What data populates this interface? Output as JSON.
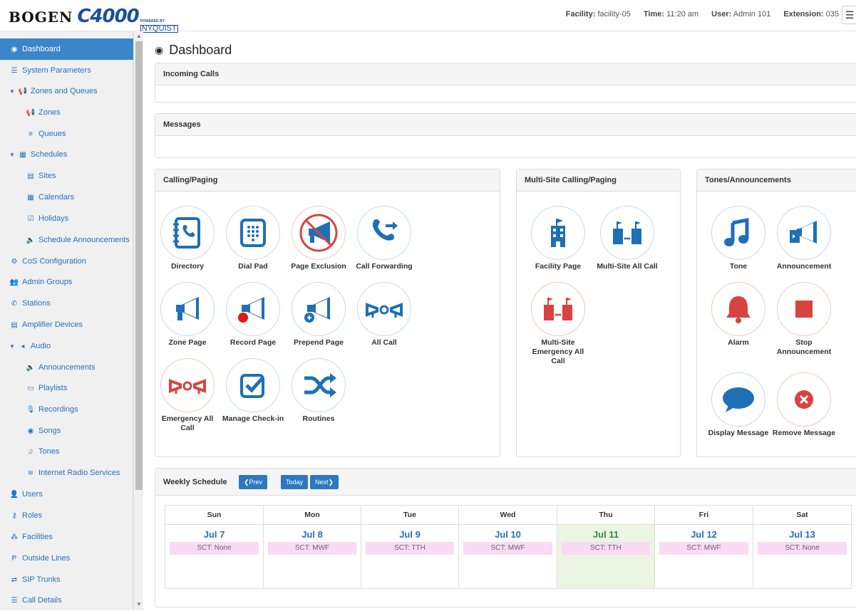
{
  "header": {
    "brand": "BOGEN",
    "product": "C4000",
    "powered_by": "POWERED BY",
    "partner": "NYQUIST",
    "facility_label": "Facility:",
    "facility_value": "facility-05",
    "time_label": "Time:",
    "time_value": "11:20 am",
    "user_label": "User:",
    "user_value": "Admin 101",
    "extension_label": "Extension:",
    "extension_value": "035",
    "menu_icon": "hamburger-icon"
  },
  "sidebar": {
    "items": [
      {
        "label": "Dashboard",
        "icon": "dashboard-icon"
      },
      {
        "label": "System Parameters",
        "icon": "list-icon"
      },
      {
        "label": "Zones and Queues",
        "icon": "megaphone-icon"
      },
      {
        "label": "Zones",
        "icon": "megaphone-icon"
      },
      {
        "label": "Queues",
        "icon": "bars-icon"
      },
      {
        "label": "Schedules",
        "icon": "calendar-icon"
      },
      {
        "label": "Sites",
        "icon": "building-icon"
      },
      {
        "label": "Calendars",
        "icon": "calendar-icon"
      },
      {
        "label": "Holidays",
        "icon": "calendar-check-icon"
      },
      {
        "label": "Schedule Announcements",
        "icon": "volume-icon"
      },
      {
        "label": "CoS Configuration",
        "icon": "cogs-icon"
      },
      {
        "label": "Admin Groups",
        "icon": "users-icon"
      },
      {
        "label": "Stations",
        "icon": "phone-icon"
      },
      {
        "label": "Amplifier Devices",
        "icon": "server-icon"
      },
      {
        "label": "Audio",
        "icon": "volume-icon"
      },
      {
        "label": "Announcements",
        "icon": "volume-icon"
      },
      {
        "label": "Playlists",
        "icon": "list-alt-icon"
      },
      {
        "label": "Recordings",
        "icon": "microphone-icon"
      },
      {
        "label": "Songs",
        "icon": "disc-icon"
      },
      {
        "label": "Tones",
        "icon": "music-icon"
      },
      {
        "label": "Internet Radio Services",
        "icon": "rss-icon"
      },
      {
        "label": "Users",
        "icon": "user-icon"
      },
      {
        "label": "Roles",
        "icon": "key-icon"
      },
      {
        "label": "Facilities",
        "icon": "sitemap-icon"
      },
      {
        "label": "Outside Lines",
        "icon": "outside-line-icon"
      },
      {
        "label": "SIP Trunks",
        "icon": "exchange-icon"
      },
      {
        "label": "Call Details",
        "icon": "list-icon"
      }
    ]
  },
  "main": {
    "title": "Dashboard",
    "incoming_calls": "Incoming Calls",
    "messages": "Messages",
    "calling_paging": {
      "title": "Calling/Paging",
      "tiles": [
        {
          "label": "Directory"
        },
        {
          "label": "Dial Pad"
        },
        {
          "label": "Page Exclusion"
        },
        {
          "label": "Call Forwarding"
        },
        {
          "label": "Zone Page"
        },
        {
          "label": "Record Page"
        },
        {
          "label": "Prepend Page"
        },
        {
          "label": "All Call"
        },
        {
          "label": "Emergency All Call"
        },
        {
          "label": "Manage Check-in"
        },
        {
          "label": "Routines"
        }
      ]
    },
    "multisite": {
      "title": "Multi-Site Calling/Paging",
      "tiles": [
        {
          "label": "Facility Page"
        },
        {
          "label": "Multi-Site All Call"
        },
        {
          "label": "Multi-Site Emergency All Call"
        }
      ]
    },
    "tones": {
      "title": "Tones/Announcements",
      "tiles": [
        {
          "label": "Tone"
        },
        {
          "label": "Announcement"
        },
        {
          "label": "Alarm"
        },
        {
          "label": "Stop Announcement"
        },
        {
          "label": "Display Message"
        },
        {
          "label": "Remove Message"
        }
      ]
    },
    "weekly": {
      "title": "Weekly Schedule",
      "prev": "Prev",
      "today": "Today",
      "next": "Next",
      "days": [
        {
          "day": "Sun",
          "date": "Jul 7",
          "sct": "SCT: None"
        },
        {
          "day": "Mon",
          "date": "Jul 8",
          "sct": "SCT: MWF"
        },
        {
          "day": "Tue",
          "date": "Jul 9",
          "sct": "SCT: TTH"
        },
        {
          "day": "Wed",
          "date": "Jul 10",
          "sct": "SCT: MWF"
        },
        {
          "day": "Thu",
          "date": "Jul 11",
          "sct": "SCT: TTH"
        },
        {
          "day": "Fri",
          "date": "Jul 12",
          "sct": "SCT: MWF"
        },
        {
          "day": "Sat",
          "date": "Jul 13",
          "sct": "SCT: None"
        }
      ]
    }
  },
  "colors": {
    "accent": "#2e78c2",
    "active_nav": "#3a86c8",
    "icon_blue": "#1f6fb5",
    "icon_red": "#d9433f",
    "today": "#eaf5e4"
  }
}
